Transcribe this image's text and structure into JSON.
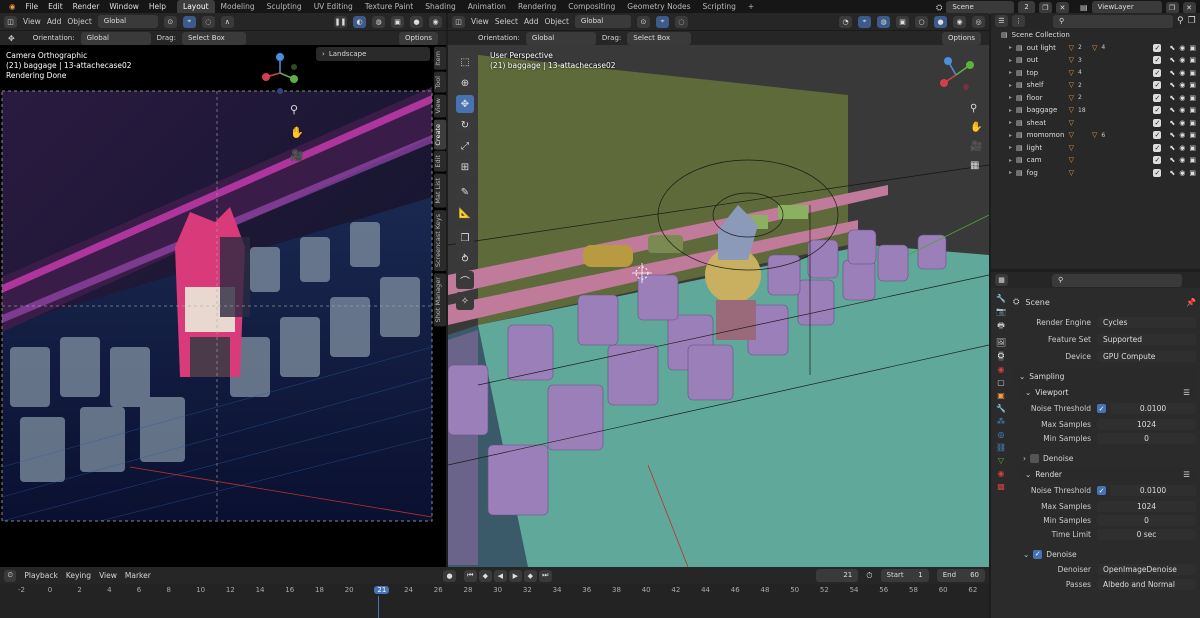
{
  "topbar": {
    "menus": [
      "File",
      "Edit",
      "Render",
      "Window",
      "Help"
    ],
    "workspace_tabs": [
      "Layout",
      "Modeling",
      "Sculpting",
      "UV Editing",
      "Texture Paint",
      "Shading",
      "Animation",
      "Rendering",
      "Compositing",
      "Geometry Nodes",
      "Scripting"
    ],
    "active_tab": "Layout",
    "add_tab": "+",
    "scene_name": "Scene",
    "scene_users": "2",
    "view_layer": "ViewLayer"
  },
  "left_viewport": {
    "menus": [
      "View",
      "Add",
      "Object"
    ],
    "transform": "Global",
    "orientation_label": "Orientation:",
    "orientation": "Global",
    "drag_label": "Drag:",
    "drag": "Select Box",
    "options": "Options",
    "info_line1": "Camera Orthographic",
    "info_line2": "(21) baggage | 13-attachecase02",
    "info_line3": "Rendering Done",
    "landscape_panel": "Landscape",
    "side_tabs": [
      "Item",
      "Tool",
      "View",
      "Create",
      "Edit",
      "Mat List",
      "Screencast Keys",
      "Shot Manager"
    ]
  },
  "right_viewport": {
    "menus": [
      "View",
      "Select",
      "Add",
      "Object"
    ],
    "transform": "Global",
    "orientation_label": "Orientation:",
    "orientation": "Global",
    "drag_label": "Drag:",
    "drag": "Select Box",
    "options": "Options",
    "info_line1": "User Perspective",
    "info_line2": "(21) baggage | 13-attachecase02"
  },
  "outliner": {
    "root": "Scene Collection",
    "items": [
      {
        "name": "out light",
        "badge": "2",
        "extra": "4"
      },
      {
        "name": "out",
        "badge": "3",
        "extra": ""
      },
      {
        "name": "top",
        "badge": "4",
        "extra": ""
      },
      {
        "name": "shelf",
        "badge": "2",
        "extra": ""
      },
      {
        "name": "floor",
        "badge": "2",
        "extra": ""
      },
      {
        "name": "baggage",
        "badge": "18",
        "extra": ""
      },
      {
        "name": "sheat",
        "badge": "",
        "extra": ""
      },
      {
        "name": "momomon",
        "badge": "",
        "extra": "6"
      },
      {
        "name": "light",
        "badge": "",
        "extra": ""
      },
      {
        "name": "cam",
        "badge": "",
        "extra": ""
      },
      {
        "name": "fog",
        "badge": "",
        "extra": ""
      }
    ]
  },
  "properties": {
    "context": "Scene",
    "render_engine_label": "Render Engine",
    "render_engine": "Cycles",
    "feature_set_label": "Feature Set",
    "feature_set": "Supported",
    "device_label": "Device",
    "device": "GPU Compute",
    "sampling_label": "Sampling",
    "viewport_label": "Viewport",
    "vp_noise_label": "Noise Threshold",
    "vp_noise": "0.0100",
    "vp_max_label": "Max Samples",
    "vp_max": "1024",
    "vp_min_label": "Min Samples",
    "vp_min": "0",
    "vp_denoise_label": "Denoise",
    "render_label": "Render",
    "r_noise_label": "Noise Threshold",
    "r_noise": "0.0100",
    "r_max_label": "Max Samples",
    "r_max": "1024",
    "r_min_label": "Min Samples",
    "r_min": "0",
    "r_time_label": "Time Limit",
    "r_time": "0 sec",
    "r_denoise_label": "Denoise",
    "denoiser_label": "Denoiser",
    "denoiser": "OpenImageDenoise",
    "passes_label": "Passes",
    "passes": "Albedo and Normal"
  },
  "timeline": {
    "menus": [
      "Playback",
      "Keying",
      "View",
      "Marker"
    ],
    "current_frame": "21",
    "start_label": "Start",
    "start": "1",
    "end_label": "End",
    "end": "60",
    "ticks": [
      "-2",
      "0",
      "2",
      "4",
      "6",
      "8",
      "10",
      "12",
      "14",
      "16",
      "18",
      "20",
      "21",
      "24",
      "26",
      "28",
      "30",
      "32",
      "34",
      "36",
      "38",
      "40",
      "42",
      "44",
      "46",
      "48",
      "50",
      "52",
      "54",
      "56",
      "58",
      "60",
      "62"
    ]
  },
  "colors": {
    "accent": "#4772b3",
    "seat_purple": "#9b7fb8",
    "floor_teal": "#5fa89a",
    "wall_olive": "#5f6a3a",
    "neon_pink": "#e040c0"
  }
}
